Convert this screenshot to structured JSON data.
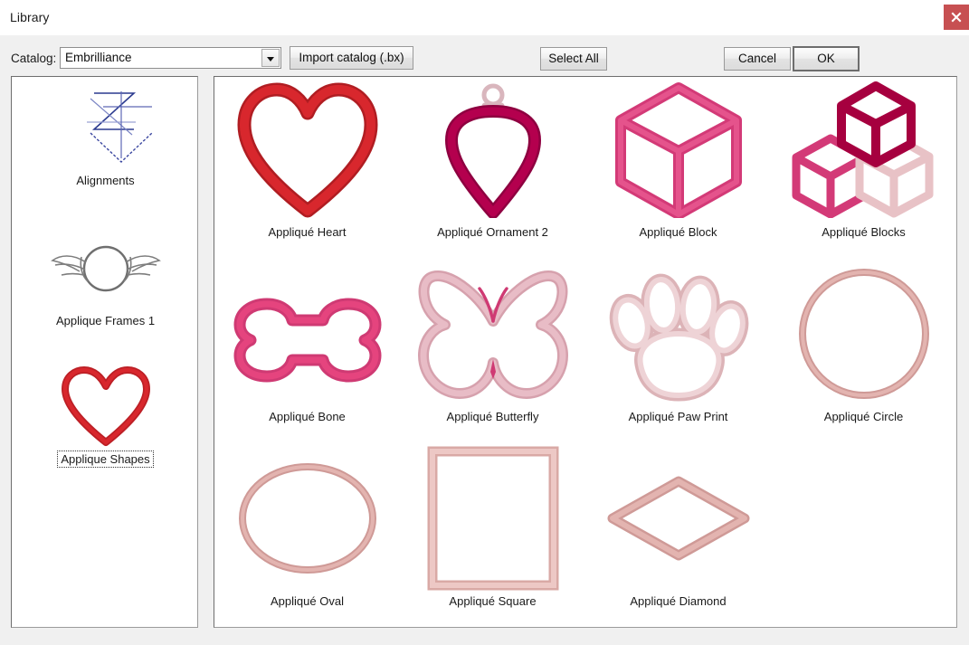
{
  "window": {
    "title": "Library",
    "close_icon": "close-icon"
  },
  "toolbar": {
    "catalog_label": "Catalog:",
    "catalog_value": "Embrilliance",
    "catalog_options": [
      "Embrilliance"
    ],
    "import_label": "Import catalog (.bx)",
    "select_all_label": "Select All",
    "cancel_label": "Cancel",
    "ok_label": "OK"
  },
  "sidebar": {
    "selected_index": 2,
    "items": [
      {
        "label": "Alignments",
        "icon": "alignments-icon"
      },
      {
        "label": "Applique Frames 1",
        "icon": "winged-circle-frame-icon"
      },
      {
        "label": "Applique Shapes",
        "icon": "red-heart-icon"
      }
    ]
  },
  "grid": {
    "items": [
      {
        "label": "Appliqué Heart",
        "icon": "heart-shape",
        "color": "#d51f26"
      },
      {
        "label": "Appliqué Ornament 2",
        "icon": "ornament-shape",
        "color": "#b4004e"
      },
      {
        "label": "Appliqué Block",
        "icon": "block-shape",
        "color": "#dd3d7c"
      },
      {
        "label": "Appliqué Blocks",
        "icon": "blocks-shape",
        "color": "#b4004e"
      },
      {
        "label": "Appliqué Bone",
        "icon": "bone-shape",
        "color": "#e5447e"
      },
      {
        "label": "Appliqué Butterfly",
        "icon": "butterfly-shape",
        "color": "#e3b5bf"
      },
      {
        "label": "Appliqué Paw Print",
        "icon": "paw-print-shape",
        "color": "#e5c3c7"
      },
      {
        "label": "Appliqué Circle",
        "icon": "circle-shape",
        "color": "#dfa9a6"
      },
      {
        "label": "Appliqué Oval",
        "icon": "oval-shape",
        "color": "#dfa9a6"
      },
      {
        "label": "Appliqué Square",
        "icon": "square-shape",
        "color": "#e3b2ae"
      },
      {
        "label": "Appliqué Diamond",
        "icon": "diamond-shape",
        "color": "#dfa9a6"
      }
    ]
  },
  "colors": {
    "close_button": "#c75052",
    "window_background": "#f0f0f0",
    "panel_background": "#ffffff",
    "accent_red": "#d51f26",
    "accent_magenta": "#b4004e",
    "accent_pink": "#dd3d7c",
    "accent_blush": "#dfa9a6"
  }
}
